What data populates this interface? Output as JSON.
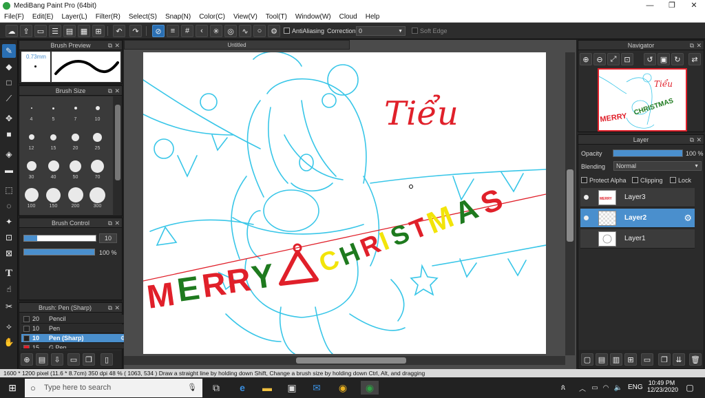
{
  "window": {
    "title": "MediBang Paint Pro (64bit)",
    "minimize": "—",
    "maximize": "❐",
    "close": "✕"
  },
  "menu": [
    "File(F)",
    "Edit(E)",
    "Layer(L)",
    "Filter(R)",
    "Select(S)",
    "Snap(N)",
    "Color(C)",
    "View(V)",
    "Tool(T)",
    "Window(W)",
    "Cloud",
    "Help"
  ],
  "toolbar": {
    "antialiasing_label": "AntiAliasing",
    "correction_label": "Correction",
    "correction_value": "0",
    "soft_edge_label": "Soft Edge"
  },
  "brush_preview": {
    "title": "Brush Preview",
    "size": "0.73mm"
  },
  "brush_size": {
    "title": "Brush Size",
    "sizes": [
      "4",
      "5",
      "7",
      "10",
      "12",
      "15",
      "20",
      "25",
      "30",
      "40",
      "50",
      "70",
      "100",
      "150",
      "200",
      "300"
    ]
  },
  "brush_control": {
    "title": "Brush Control",
    "size_value": "10",
    "opacity_value": "100 %"
  },
  "brush_list": {
    "title": "Brush: Pen (Sharp)",
    "items": [
      {
        "size": "20",
        "name": "Pencil"
      },
      {
        "size": "10",
        "name": "Pen"
      },
      {
        "size": "10",
        "name": "Pen (Sharp)"
      },
      {
        "size": "15",
        "name": "G Pen"
      }
    ]
  },
  "document": {
    "tab": "Untitled",
    "text_tieu": "Tiểu",
    "text_merry": "MERRY",
    "text_christmas": "CHRISTMAS"
  },
  "navigator": {
    "title": "Navigator"
  },
  "layer_panel": {
    "title": "Layer",
    "opacity_label": "Opacity",
    "opacity_value": "100 %",
    "opacity_level": 1.0,
    "blending_label": "Blending",
    "blending_value": "Normal",
    "protect_alpha": "Protect Alpha",
    "clipping": "Clipping",
    "lock": "Lock",
    "layers": [
      {
        "name": "Layer3"
      },
      {
        "name": "Layer2"
      },
      {
        "name": "Layer1"
      }
    ]
  },
  "status": {
    "text": "1600 * 1200 pixel   (11.6 * 8.7cm)   350 dpi   48 %   ( 1063, 534 )   Draw a straight line by holding down Shift, Change a brush size by holding down Ctrl, Alt, and dragging"
  },
  "taskbar": {
    "search_placeholder": "Type here to search",
    "language": "ENG",
    "time": "10:49 PM",
    "date": "12/23/2020"
  },
  "colors": {
    "accent": "#4a8fcd",
    "sketch": "#38c6e8",
    "red": "#e0202a",
    "green": "#1e7a1e",
    "yellow": "#f2e40a"
  }
}
